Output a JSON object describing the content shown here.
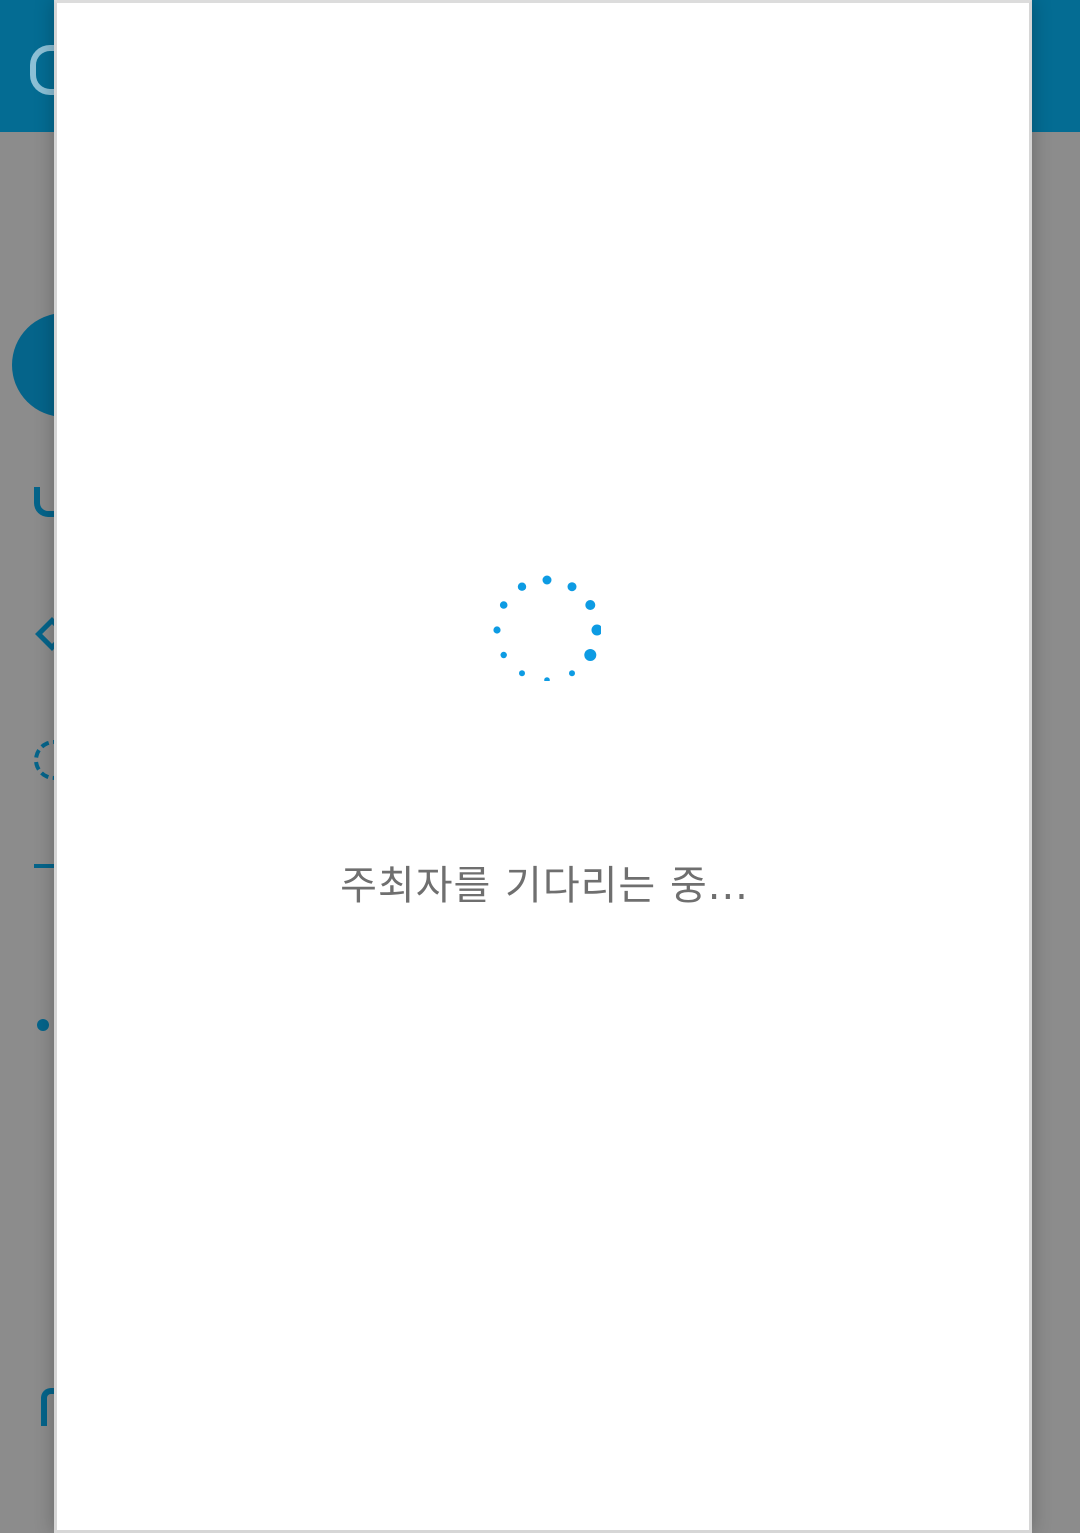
{
  "dialog": {
    "status_text": "주최자를 기다리는 중..."
  },
  "spinner": {
    "icon": "loading-spinner-icon",
    "color": "#0d9be3"
  },
  "background": {
    "topbar_color": "#046c93",
    "overlay_color": "#8c8c8c"
  }
}
